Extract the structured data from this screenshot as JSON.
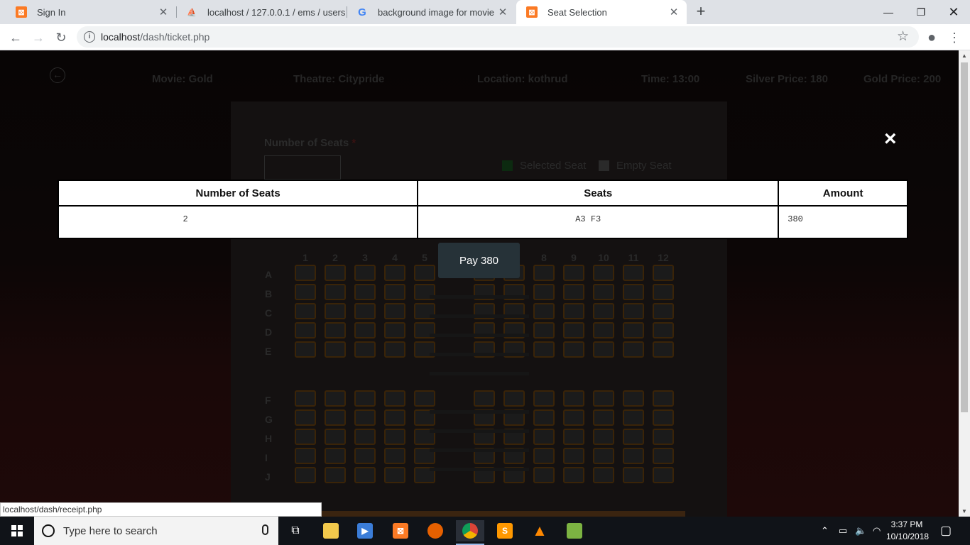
{
  "browser": {
    "tabs": [
      {
        "title": "Sign In",
        "icon": "xampp-icon"
      },
      {
        "title": "localhost / 127.0.0.1 / ems / users",
        "icon": "phpmyadmin-icon"
      },
      {
        "title": "background image for movie boo",
        "icon": "google-icon"
      },
      {
        "title": "Seat Selection",
        "icon": "xampp-icon"
      }
    ],
    "url_host": "localhost",
    "url_path": "/dash/ticket.php",
    "status_url": "localhost/dash/receipt.php"
  },
  "page": {
    "movie": "Movie: Gold",
    "theatre": "Theatre: Citypride",
    "location": "Location: kothrud",
    "time": "Time: 13:00",
    "silver_price": "Silver Price: 180",
    "gold_price": "Gold Price: 200",
    "seats_label": "Number of Seats",
    "required_mark": "*",
    "legend_selected": "Selected Seat",
    "legend_empty": "Empty Seat",
    "columns": [
      "1",
      "2",
      "3",
      "4",
      "5",
      "6",
      "7",
      "8",
      "9",
      "10",
      "11",
      "12"
    ],
    "rows": [
      "A",
      "B",
      "C",
      "D",
      "E",
      "F",
      "G",
      "H",
      "I",
      "J"
    ]
  },
  "modal": {
    "headers": {
      "seats_count": "Number of Seats",
      "seats": "Seats",
      "amount": "Amount"
    },
    "row": {
      "seats_count": "2",
      "seats": "A3 F3",
      "amount": "380"
    },
    "pay_label": "Pay 380",
    "close_glyph": "×"
  },
  "taskbar": {
    "search_placeholder": "Type here to search",
    "time": "3:37 PM",
    "date": "10/10/2018"
  },
  "colors": {
    "xampp": "#fb7a24",
    "pay_button": "#263238",
    "seat_border": "#3a2408"
  }
}
